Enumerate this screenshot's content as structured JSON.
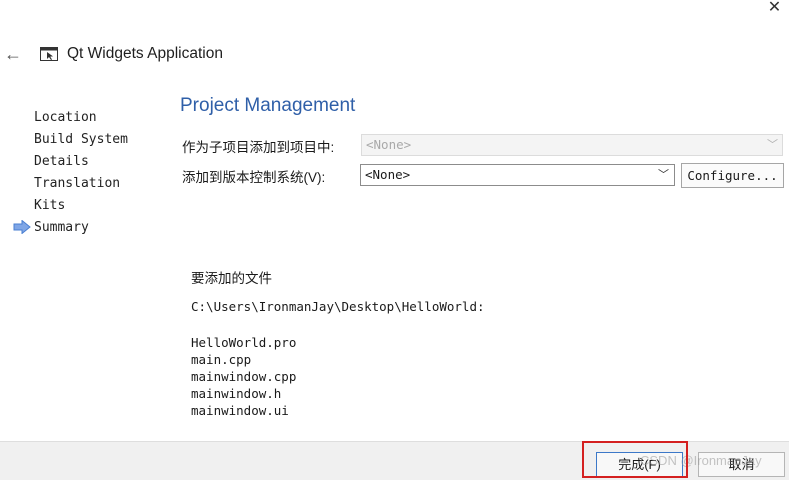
{
  "titlebar": {
    "close_glyph": "✕",
    "back_glyph": "←",
    "app_title": "Qt Widgets Application",
    "app_icon": "window-cursor-icon"
  },
  "steps": {
    "items": [
      {
        "label": "Location",
        "current": false
      },
      {
        "label": "Build System",
        "current": false
      },
      {
        "label": "Details",
        "current": false
      },
      {
        "label": "Translation",
        "current": false
      },
      {
        "label": "Kits",
        "current": false
      },
      {
        "label": "Summary",
        "current": true
      }
    ],
    "current_indicator": "arrow-right-icon",
    "accent_color": "#4a7fd1"
  },
  "main": {
    "heading": "Project Management",
    "heading_color": "#2f5fa8",
    "subproject": {
      "label": "作为子项目添加到项目中:",
      "value": "<None>",
      "disabled": true
    },
    "vcs": {
      "label": "添加到版本控制系统(V):",
      "value": "<None>",
      "configure_label": "Configure..."
    },
    "files": {
      "heading": "要添加的文件",
      "path": "C:\\Users\\IronmanJay\\Desktop\\HelloWorld:",
      "list": [
        "HelloWorld.pro",
        "main.cpp",
        "mainwindow.cpp",
        "mainwindow.h",
        "mainwindow.ui"
      ]
    }
  },
  "footer": {
    "finish_label": "完成(F)",
    "cancel_label": "取消",
    "watermark": "CSDN @IronmanJay",
    "highlight_color": "#d42020"
  }
}
